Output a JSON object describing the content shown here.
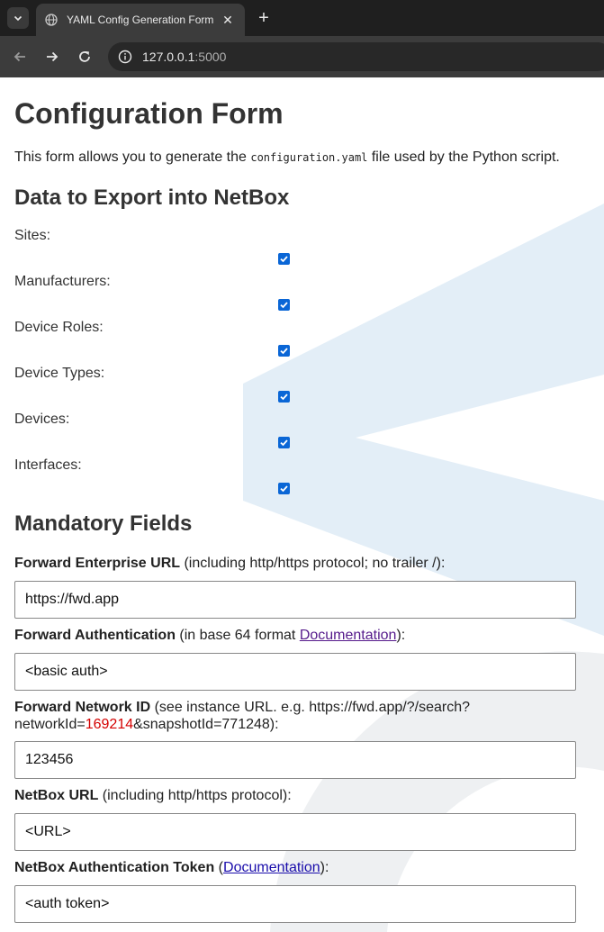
{
  "browser": {
    "tab_title": "YAML Config Generation Form",
    "url": "127.0.0.1:5000",
    "url_host": "127.0.0.1",
    "url_port": ":5000"
  },
  "page": {
    "title": "Configuration Form",
    "intro_before": "This form allows you to generate the ",
    "intro_code": "configuration.yaml",
    "intro_after": " file used by the Python script.",
    "export_heading": "Data to Export into NetBox",
    "export_items": [
      {
        "label": "Sites:",
        "checked": true
      },
      {
        "label": "Manufacturers:",
        "checked": true
      },
      {
        "label": "Device Roles:",
        "checked": true
      },
      {
        "label": "Device Types:",
        "checked": true
      },
      {
        "label": "Devices:",
        "checked": true
      },
      {
        "label": "Interfaces:",
        "checked": true
      }
    ],
    "mandatory_heading": "Mandatory Fields",
    "fields": {
      "fwd_url": {
        "label_bold": "Forward Enterprise URL",
        "label_rest": " (including http/https protocol; no trailer /):",
        "value": "https://fwd.app"
      },
      "fwd_auth": {
        "label_bold": "Forward Authentication",
        "label_rest": " (in base 64 format ",
        "link": "Documentation",
        "label_end": "):",
        "value": "<basic auth>"
      },
      "fwd_network": {
        "label_bold": "Forward Network ID",
        "label_rest": " (see instance URL. e.g. https://fwd.app/?/search?",
        "line2_before": "networkId=",
        "line2_red": "169214",
        "line2_after": "&snapshotId=771248):",
        "value": "123456"
      },
      "netbox_url": {
        "label_bold": "NetBox URL",
        "label_rest": " (including http/https protocol):",
        "value": "<URL>"
      },
      "netbox_token": {
        "label_bold": "NetBox Authentication Token",
        "label_rest": " (",
        "link": "Documentation",
        "label_end": "):",
        "value": "<auth token>"
      }
    }
  },
  "colors": {
    "checkbox": "#0a66d6",
    "link": "#1a0dab",
    "visited_link": "#551a8b",
    "highlight": "#d40000"
  }
}
